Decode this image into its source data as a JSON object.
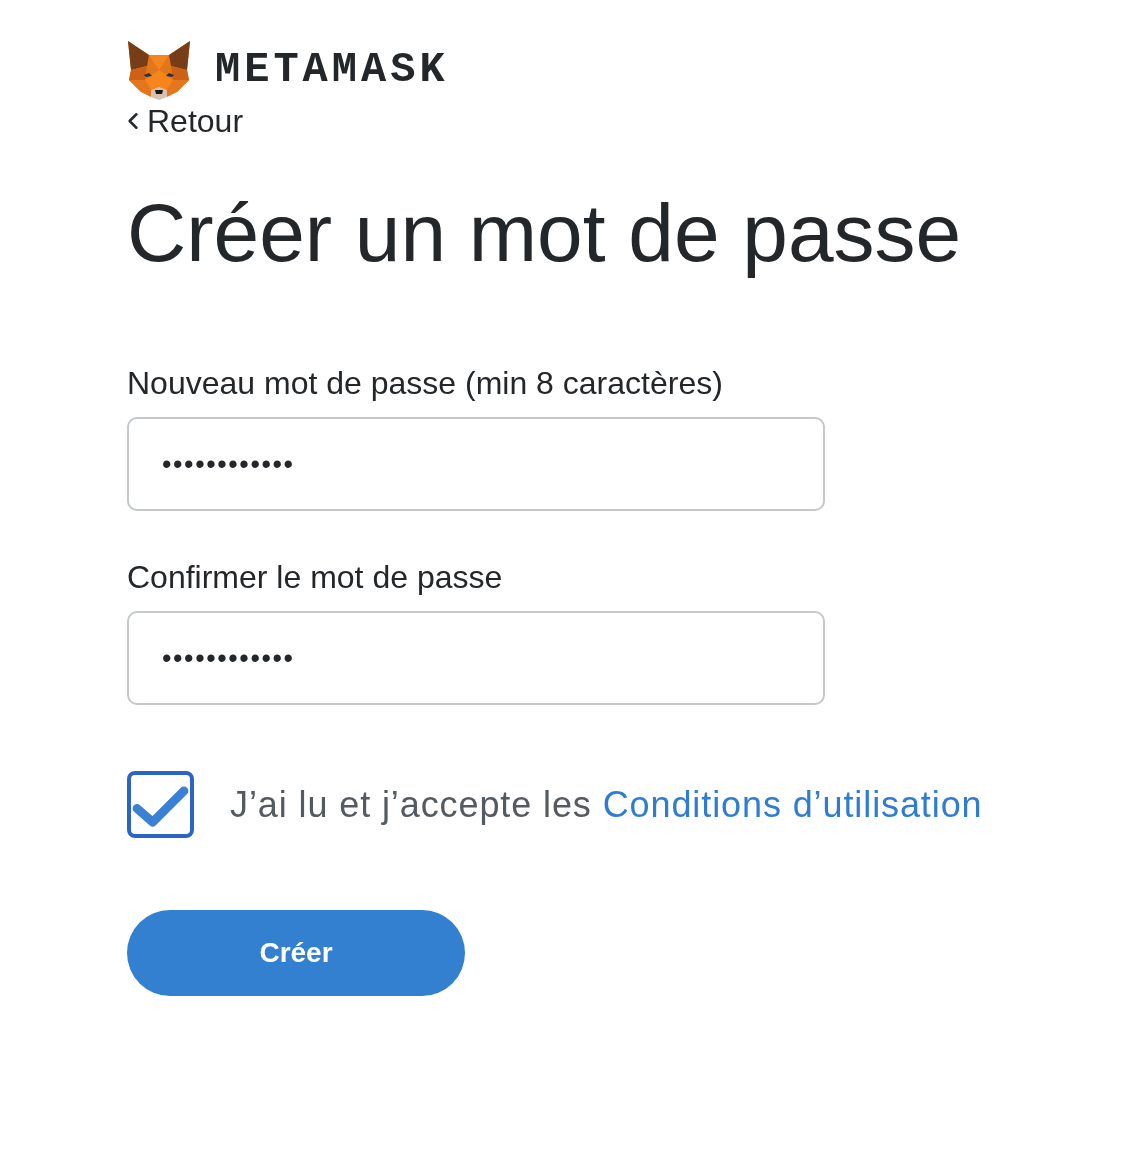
{
  "header": {
    "brand_name": "METAMASK",
    "back_link": "Retour"
  },
  "title": "Créer un mot de passe",
  "fields": [
    {
      "label": "Nouveau mot de passe (min 8 caractères)",
      "value": "••••••••••••"
    },
    {
      "label": "Confirmer le mot de passe",
      "value": "••••••••••••"
    }
  ],
  "terms": {
    "checked": true,
    "text": "J’ai lu et j’accepte les",
    "link": "Conditions d’utilisation"
  },
  "submit_button": "Créer"
}
